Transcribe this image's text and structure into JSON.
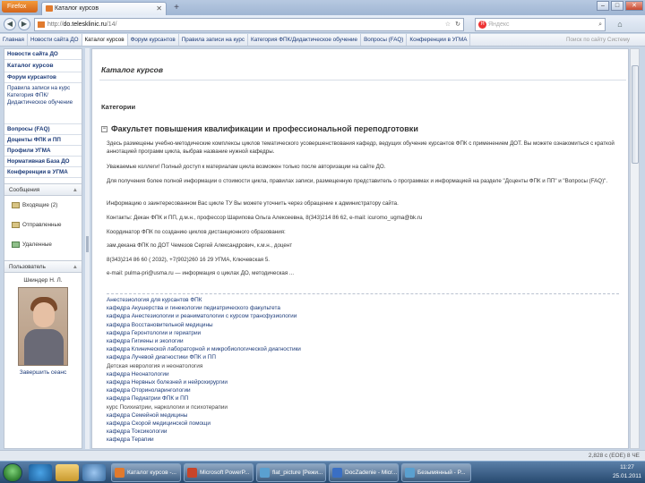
{
  "browser": {
    "menu_label": "Firefox",
    "tab_title": "Каталог курсов",
    "new_tab": "+",
    "url_prefix": "http://",
    "url_site": "do.telesklinic.ru",
    "url_path": "/14/",
    "search_placeholder": "Яндекс",
    "window_buttons": [
      "–",
      "□",
      "✕"
    ]
  },
  "site_nav": {
    "items": [
      "Главная",
      "Новости сайта ДО",
      "Каталог курсов",
      "Форум курсантов",
      "Правила записи на курс",
      "Категория ФПК/Дидактическое обучение",
      "Вопросы (FAQ)",
      "Конференции в УГМА"
    ],
    "active_index": 2,
    "login": "Поиск по сайту   Систему"
  },
  "sidebar": {
    "items": [
      "Новости сайта ДО",
      "Каталог курсов",
      "Форум курсантов",
      "Правила записи на курс Категория ФПК/Дидактическое обучение",
      "Вопросы (FAQ)",
      "Доценты ФПК и ПП",
      "Профили УГМА",
      "Нормативная База ДО",
      "Конференции в УГМА"
    ],
    "messages_header": "Сообщения",
    "messages": [
      "Входящие (2)",
      "Отправленные",
      "Удаленные"
    ],
    "user_header": "Пользователь",
    "user_name": "Шкиндер Н. Л.",
    "logout": "Завершить сеанс",
    "toggle": "▲"
  },
  "content": {
    "page_title": "Каталог курсов",
    "categories_label": "Категории",
    "faculty_title": "Факультет повышения квалификации и профессиональной переподготовки",
    "paragraphs": [
      "Здесь размещены учебно-методические комплексы циклов тематического усовершенствования кафедр, ведущих обучение курсантов ФПК с применением ДОТ. Вы можете ознакомиться с краткой аннотацией программ цикла, выбрав название нужной кафедры.",
      "Уважаемые коллеги! Полный доступ к материалам цикла возможен только после авторизации на сайте ДО.",
      "Для получения более полной информации о стоимости цикла, правилах записи, размещенную представитель о программах и информацией на разделе \"Доценты ФПК и ПП\" и \"Вопросы (FAQ)\".",
      "Информацию о заинтересованном Вас цикле ТУ Вы можете уточнить через обращение к администратору сайта.",
      "Контакты: Декан ФПК и ПП, д.м.н., профессор Шарипова Ольга Алексеевна, 8(343)214 86 62, e-mail: icuromo_ugma@bk.ru",
      "Координатор ФПК по созданию циклов дистанционного образования:",
      "зам.декана ФПК по ДОТ Чемезов Сергей Александрович, к.м.н., доцент",
      "8(343)214 86 60 ( 2032),  +7(902)260 16 29   УГМА, Ключевская 5.",
      "e-mail: pulma-pri@usma.ru — информация о циклах ДО, методическая ..."
    ],
    "course_links": [
      "Анестезиология для курсантов ФПК",
      "кафедра Акушерства и гинекологии педиатрического факультета",
      "кафедра Анестезиологии и реаниматологии с курсом трансфузиологии",
      "кафедра Восстановительной медицины",
      "кафедра Геронтологии и гериатрии",
      "кафедра Гигиены и экологии",
      "кафедра Клинической лабораторной и микробиологической диагностики",
      "кафедра Лучевой диагностики ФПК и ПП",
      "Детская неврология и неонатология",
      "кафедра Неонатологии",
      "кафедра Нервных болезней и нейрохирургии",
      "кафедра Оториноларингологии",
      "кафедра Педиатрии ФПК и ПП",
      "курс Психиатрии, наркологии и психотерапии",
      "кафедра Семейной медицины",
      "кафедра Скорой медицинской помощи",
      "кафедра Токсикологии",
      "кафедра Терапии"
    ]
  },
  "status_bar": {
    "right_text": "2,828 с (ЕОЕ) 8 ЧЕ"
  },
  "taskbar": {
    "tasks": [
      "Каталог курсов -...",
      "Microsoft PowerP...",
      "flat_picture [Режи...",
      "DocZadenie - Micr...",
      "Безымянный - P..."
    ],
    "time": "11:27",
    "date": "25.01.2011",
    "colors": {
      "firefox": "#e07a2e",
      "powerpoint": "#c8452a",
      "word": "#3a6fc4",
      "paint": "#5aa0d0"
    }
  }
}
